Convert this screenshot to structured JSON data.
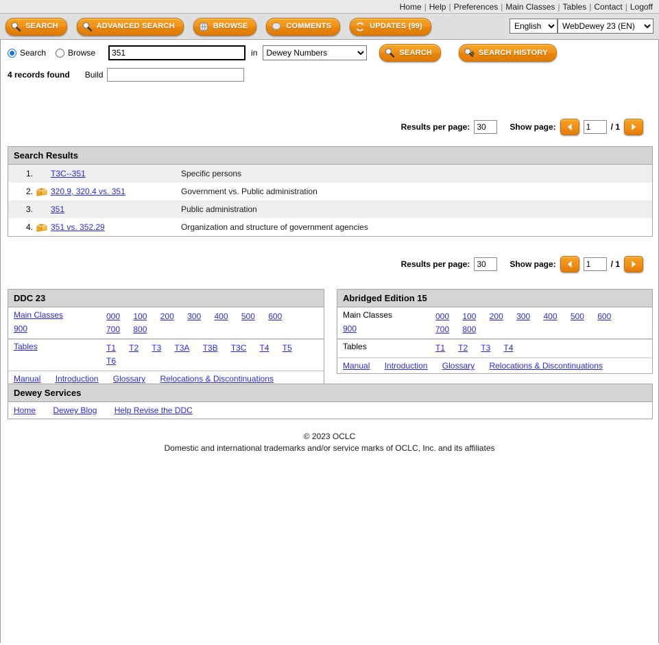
{
  "topnav": {
    "links": [
      {
        "label": "Home"
      },
      {
        "label": "Help"
      },
      {
        "label": "Preferences"
      },
      {
        "label": "Main Classes"
      },
      {
        "label": "Tables"
      },
      {
        "label": "Contact"
      },
      {
        "label": "Logoff"
      }
    ],
    "separator": "|"
  },
  "toolbar": {
    "buttons": [
      {
        "label": "SEARCH",
        "icon": "magnifier-icon"
      },
      {
        "label": "ADVANCED SEARCH",
        "icon": "magnifier-icon"
      },
      {
        "label": "BROWSE",
        "icon": "globe-icon"
      },
      {
        "label": "COMMENTS",
        "icon": "speech-bubble-icon"
      },
      {
        "label": "UPDATES (99)",
        "icon": "refresh-icon"
      }
    ],
    "language_selected": "English",
    "language_options": [
      "English"
    ],
    "edition_selected": "WebDewey 23 (EN)",
    "edition_options": [
      "WebDewey 23 (EN)"
    ]
  },
  "searchbar": {
    "mode_search_label": "Search",
    "mode_browse_label": "Browse",
    "mode_selected": "Search",
    "query_value": "351",
    "query_placeholder": "",
    "in_label": "in",
    "field_selected": "Dewey Numbers",
    "field_options": [
      "Dewey Numbers"
    ],
    "search_button_label": "SEARCH",
    "history_button_label": "SEARCH HISTORY"
  },
  "buildbar": {
    "records_found": "4 records found",
    "build_label": "Build",
    "build_value": "",
    "build_placeholder": ""
  },
  "pager": {
    "results_per_page_label": "Results per page:",
    "results_per_page_value": "30",
    "show_page_label": "Show page:",
    "page_value": "1",
    "total_pages": "/ 1",
    "prev_icon": "arrow-left-icon",
    "next_icon": "arrow-right-icon"
  },
  "results": {
    "title": "Search Results",
    "rows": [
      {
        "num": "1.",
        "icon": "",
        "value": "T3C--351",
        "description": "Specific persons"
      },
      {
        "num": "2.",
        "icon": "book-icon",
        "value": "320.9, 320.4 vs. 351",
        "description": "Government vs. Public administration"
      },
      {
        "num": "3.",
        "icon": "",
        "value": "351",
        "description": "Public administration"
      },
      {
        "num": "4.",
        "icon": "book-icon",
        "value": "351 vs. 352.29",
        "description": "Organization and structure of government agencies"
      }
    ]
  },
  "ddc23": {
    "title": "DDC 23",
    "main_classes_label": "Main Classes",
    "main_classes_is_link": true,
    "main_classes": [
      "000",
      "100",
      "200",
      "300",
      "400",
      "500",
      "600",
      "700",
      "800",
      "900"
    ],
    "tables_label": "Tables",
    "tables_is_link": true,
    "tables": [
      "T1",
      "T2",
      "T3",
      "T3A",
      "T3B",
      "T3C",
      "T4",
      "T5",
      "T6"
    ],
    "bottom_links": [
      "Manual",
      "Introduction",
      "Glossary",
      "Relocations & Discontinuations"
    ]
  },
  "abridged15": {
    "title": "Abridged Edition 15",
    "main_classes_label": "Main Classes",
    "main_classes_is_link": false,
    "main_classes": [
      "000",
      "100",
      "200",
      "300",
      "400",
      "500",
      "600",
      "700",
      "800",
      "900"
    ],
    "tables_label": "Tables",
    "tables_is_link": false,
    "tables": [
      "T1",
      "T2",
      "T3",
      "T4"
    ],
    "bottom_links": [
      "Manual",
      "Introduction",
      "Glossary",
      "Relocations & Discontinuations"
    ]
  },
  "services": {
    "title": "Dewey Services",
    "links": [
      "Home",
      "Dewey Blog",
      "Help Revise the DDC"
    ]
  },
  "footer": {
    "copyright": "© 2023 OCLC",
    "trademark": "Domestic and international trademarks and/or service marks of OCLC, Inc. and its affiliates"
  },
  "colors": {
    "accent_orange": "#ef8c10",
    "link_blue": "#2a2ad6",
    "panel_header_gray": "#d4d4d4",
    "row_stripe": "#eeeeee"
  }
}
